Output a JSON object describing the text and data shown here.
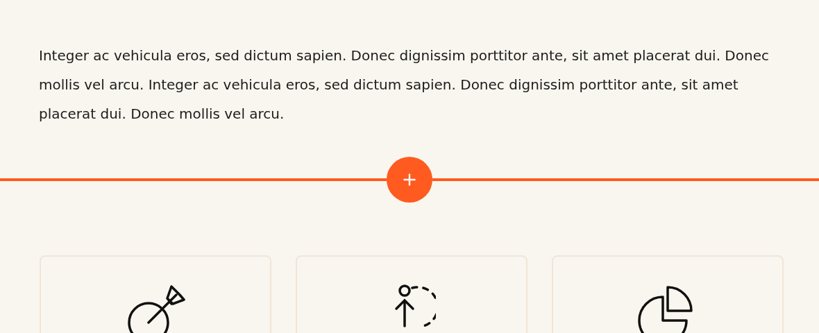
{
  "intro": {
    "text": "Integer ac vehicula eros, sed dictum sapien. Donec dignissim porttitor ante, sit amet placerat dui. Donec mollis vel arcu. Integer ac vehicula eros, sed dictum sapien. Donec dignissim porttitor ante, sit amet placerat dui. Donec mollis vel arcu."
  },
  "cards": [
    {
      "kind": "target"
    },
    {
      "kind": "person"
    },
    {
      "kind": "pie"
    }
  ]
}
